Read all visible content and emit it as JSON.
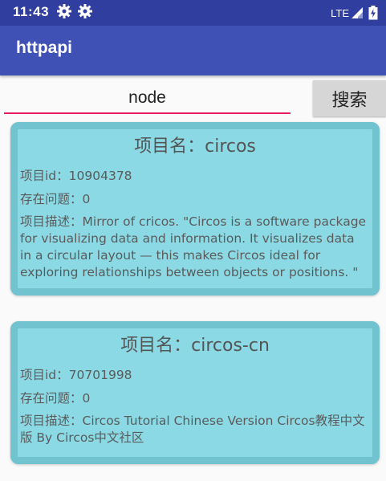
{
  "status_bar": {
    "time": "11:43",
    "network": "LTE",
    "icons": [
      "gear-icon",
      "gear-icon",
      "signal-icon",
      "battery-icon"
    ]
  },
  "app_bar": {
    "title": "httpapi"
  },
  "search": {
    "value": "node",
    "button_label": "搜索"
  },
  "labels": {
    "name": "项目名：",
    "id": "项目id：",
    "issues": "存在问题：",
    "desc": "项目描述："
  },
  "projects": [
    {
      "name": "circos",
      "id": "10904378",
      "issues": "0",
      "description": "Mirror of cricos.  \"Circos is a software package for visualizing data and information. It visualizes data in a circular layout — this makes Circos ideal for exploring relationships between objects or positions. \""
    },
    {
      "name": "circos-cn",
      "id": "70701998",
      "issues": "0",
      "description": "Circos  Tutorial Chinese Version       Circos教程中文版 By Circos中文社区"
    }
  ],
  "colors": {
    "status_bar": "#303f9f",
    "app_bar": "#3f51b5",
    "accent": "#e91e63",
    "card_fill": "#8ad9e4",
    "card_border": "#70c3cf"
  }
}
